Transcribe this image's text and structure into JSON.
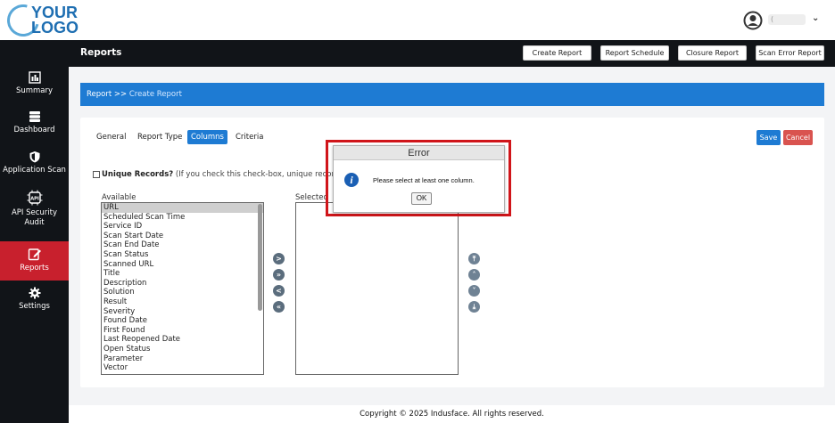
{
  "logo": {
    "line1": "YOUR",
    "line2": "LOGO"
  },
  "user": {
    "name": "(",
    "menu_icon": "chevron-down-icon"
  },
  "header": {
    "title": "Reports",
    "buttons": [
      "Create Report",
      "Report Schedule",
      "Closure Report",
      "Scan Error Report"
    ]
  },
  "sidebar": {
    "items": [
      {
        "label": "Summary",
        "icon": "summary-icon"
      },
      {
        "label": "Dashboard",
        "icon": "dashboard-icon"
      },
      {
        "label": "Application Scan",
        "icon": "shield-icon"
      },
      {
        "label": "API Security Audit",
        "icon": "api-icon"
      },
      {
        "label": "Reports",
        "icon": "edit-report-icon",
        "active": true
      },
      {
        "label": "Settings",
        "icon": "gear-icon"
      }
    ]
  },
  "breadcrumb": {
    "root": "Report >>",
    "current": "Create Report"
  },
  "tabs": [
    "General",
    "Report Type",
    "Columns",
    "Criteria"
  ],
  "active_tab": "Columns",
  "actions": {
    "save": "Save",
    "cancel": "Cancel"
  },
  "unique": {
    "label": "Unique Records?",
    "hint": "(If you check this check-box, unique records will l"
  },
  "columns": {
    "available_label": "Available",
    "selected_label": "Selected",
    "available": [
      "URL",
      "Scheduled Scan Time",
      "Service ID",
      "Scan Start Date",
      "Scan End Date",
      "Scan Status",
      "Scanned URL",
      "Title",
      "Description",
      "Solution",
      "Result",
      "Severity",
      "Found Date",
      "First Found",
      "Last Reopened Date",
      "Open Status",
      "Parameter",
      "Vector"
    ],
    "selected_item": "URL",
    "selected": []
  },
  "transfer_buttons": [
    ">",
    "»",
    "<",
    "«"
  ],
  "order_buttons": [
    "⤒",
    "˄",
    "˅",
    "⤓"
  ],
  "dialog": {
    "title": "Error",
    "message": "Please select at least one column.",
    "ok": "OK"
  },
  "footer": "Copyright © 2025 Indusface. All rights reserved.",
  "colors": {
    "accent": "#1e7bd3",
    "sidebar": "#111418",
    "active": "#c8202d",
    "danger": "#d9534f",
    "highlight_frame": "#d0151a"
  }
}
